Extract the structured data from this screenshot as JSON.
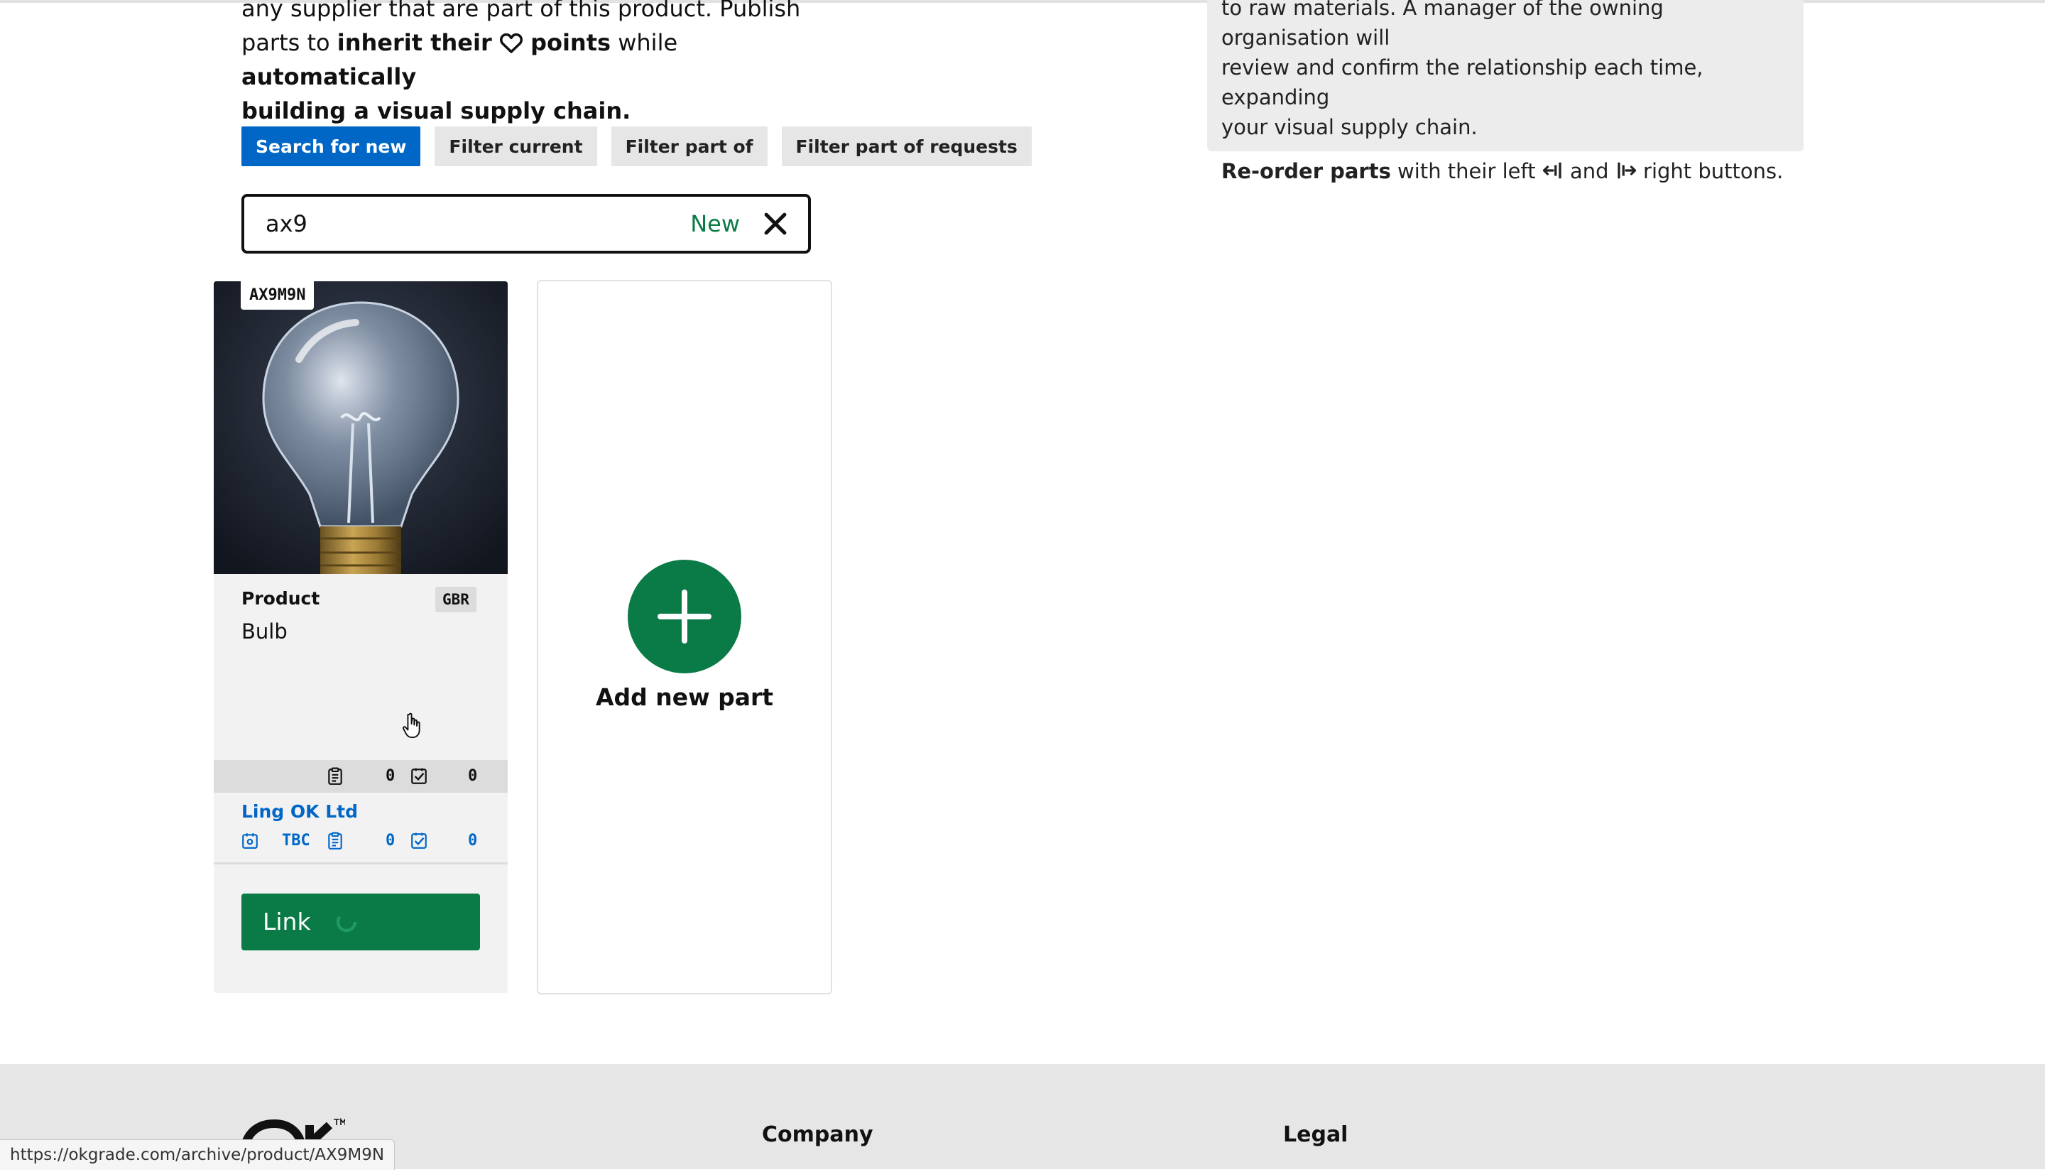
{
  "intro": {
    "line1": "any supplier that are part of this product. Publish",
    "line2_pre": "parts to ",
    "line2_bold1": "inherit their",
    "line2_bold2": "points",
    "line2_mid": " while ",
    "line2_bold3": "automatically",
    "line3_bold": "building a visual supply chain."
  },
  "filters": {
    "search_new": "Search for new",
    "filter_current": "Filter current",
    "filter_part_of": "Filter part of",
    "filter_part_of_requests": "Filter part of requests"
  },
  "search": {
    "value": "ax9",
    "new_label": "New"
  },
  "info_panel": {
    "line1": "to raw materials. A manager of the owning organisation will",
    "line2": "review and confirm the relationship each time, expanding",
    "line3": "your visual supply chain.",
    "reorder_bold": "Re-order parts",
    "reorder_pre": " with their left ",
    "reorder_and": " and ",
    "reorder_post": " right buttons."
  },
  "product_card": {
    "code": "AX9M9N",
    "type": "Product",
    "country": "GBR",
    "name": "Bulb",
    "stats": {
      "docs": "0",
      "checks": "0"
    },
    "supplier": {
      "name": "Ling OK Ltd",
      "status": "TBC",
      "docs": "0",
      "checks": "0"
    },
    "link_label": "Link"
  },
  "add_card": {
    "label": "Add new part"
  },
  "footer": {
    "company": "Company",
    "legal": "Legal"
  },
  "statusbar": {
    "url": "https://okgrade.com/archive/product/AX9M9N"
  },
  "colors": {
    "primary_blue": "#0067c7",
    "brand_green": "#0a7a46",
    "panel_grey": "#ececec"
  }
}
